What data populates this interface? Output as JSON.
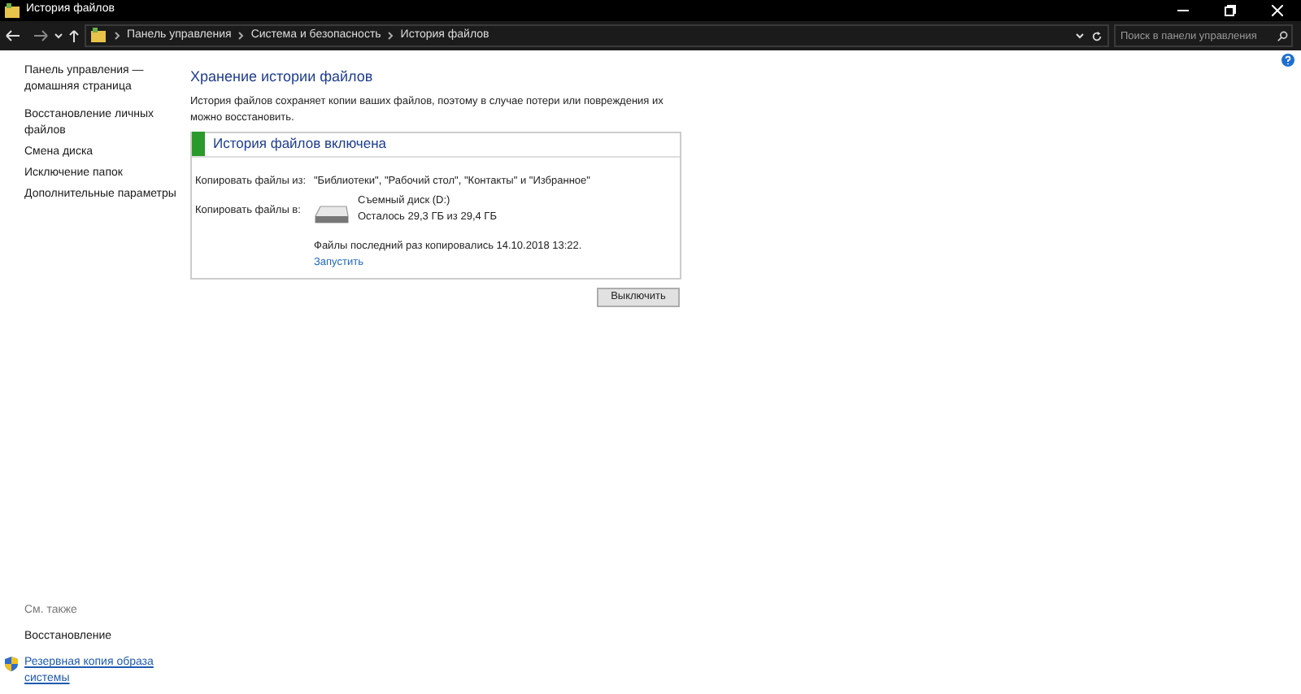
{
  "window": {
    "title": "История файлов"
  },
  "address_bar": {
    "breadcrumbs": [
      "Панель управления",
      "Система и безопасность",
      "История файлов"
    ],
    "search": {
      "placeholder": "Поиск в панели управления"
    }
  },
  "sidebar": {
    "items": [
      {
        "label": "Панель управления — домашняя страница"
      },
      {
        "label": "Восстановление личных файлов"
      },
      {
        "label": "Смена диска"
      },
      {
        "label": "Исключение папок"
      },
      {
        "label": "Дополнительные параметры"
      }
    ],
    "see_also": {
      "heading": "См. также",
      "links": [
        {
          "label": "Восстановление",
          "kind": "plain"
        },
        {
          "label": "Резервная копия образа системы",
          "kind": "shield"
        }
      ]
    }
  },
  "main": {
    "heading": "Хранение истории файлов",
    "description": "История файлов сохраняет копии ваших файлов, поэтому в случае потери или повреждения их можно восстановить.",
    "status": {
      "title": "История файлов включена",
      "on": true
    },
    "copy_from": {
      "label": "Копировать файлы из:",
      "value": "\"Библиотеки\", \"Рабочий стол\", \"Контакты\" и \"Избранное\""
    },
    "copy_to": {
      "label": "Копировать файлы в:",
      "drive_name": "Съемный диск (D:)",
      "drive_space": "Осталось 29,3 ГБ из 29,4 ГБ"
    },
    "last_copy": "Файлы последний раз копировались 14.10.2018 13:22.",
    "run_link": "Запустить",
    "button": "Выключить"
  }
}
